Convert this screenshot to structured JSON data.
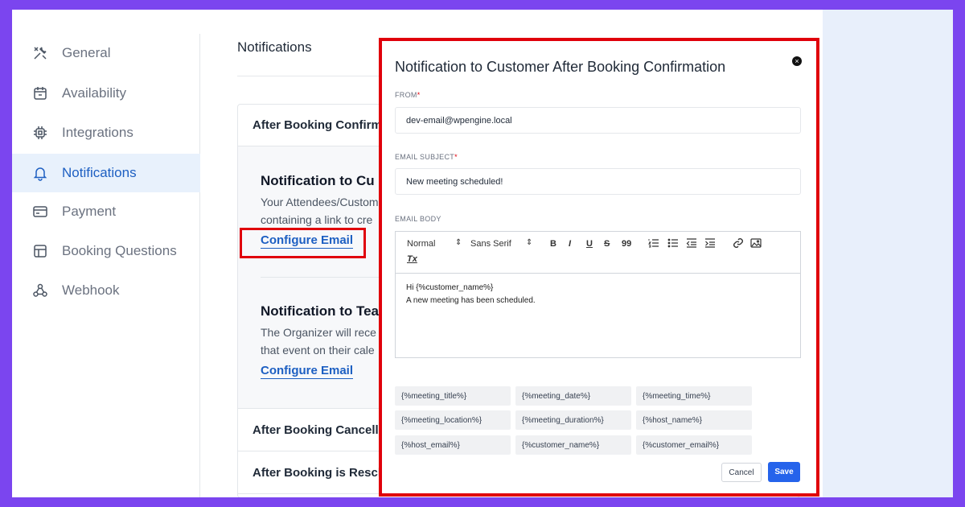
{
  "sidebar": {
    "items": [
      {
        "label": "General",
        "icon": "tools-icon",
        "active": false
      },
      {
        "label": "Availability",
        "icon": "calendar-icon",
        "active": false
      },
      {
        "label": "Integrations",
        "icon": "chip-icon",
        "active": false
      },
      {
        "label": "Notifications",
        "icon": "bell-icon",
        "active": true
      },
      {
        "label": "Payment",
        "icon": "card-icon",
        "active": false
      },
      {
        "label": "Booking Questions",
        "icon": "layout-icon",
        "active": false
      },
      {
        "label": "Webhook",
        "icon": "webhook-icon",
        "active": false
      }
    ]
  },
  "main": {
    "title": "Notifications",
    "sections": {
      "confirmation": "After Booking Confirm",
      "cancellation": "After Booking Cancell",
      "rescheduled": "After Booking is Resch"
    },
    "customer_notification": {
      "title": "Notification to Cu",
      "desc_line1": "Your Attendees/Custom",
      "desc_line2": "containing a link to cre",
      "link": "Configure Email"
    },
    "team_notification": {
      "title": "Notification to Tea",
      "desc_line1": "The Organizer will rece",
      "desc_line2": "that event on their cale",
      "link": "Configure Email"
    }
  },
  "modal": {
    "title": "Notification to Customer After Booking Confirmation",
    "close": "×",
    "from_label": "FROM",
    "from_value": "dev-email@wpengine.local",
    "subject_label": "EMAIL SUBJECT",
    "subject_value": "New meeting scheduled!",
    "body_label": "EMAIL BODY",
    "toolbar": {
      "size": "Normal",
      "font": "Sans Serif",
      "bold": "B",
      "italic": "I",
      "underline": "U",
      "strike": "S",
      "quote": "99",
      "clear": "Tx"
    },
    "body_line1": "Hi {%customer_name%}",
    "body_line2": "A new meeting has been scheduled.",
    "tags": [
      "{%meeting_title%}",
      "{%meeting_date%}",
      "{%meeting_time%}",
      "{%meeting_location%}",
      "{%meeting_duration%}",
      "{%host_name%}",
      "{%host_email%}",
      "{%customer_name%}",
      "{%customer_email%}"
    ],
    "cancel_label": "Cancel",
    "save_label": "Save"
  },
  "colors": {
    "accent": "#1d5fc2",
    "highlight": "#e0000b",
    "background": "#7b45ef",
    "save": "#2563eb"
  }
}
